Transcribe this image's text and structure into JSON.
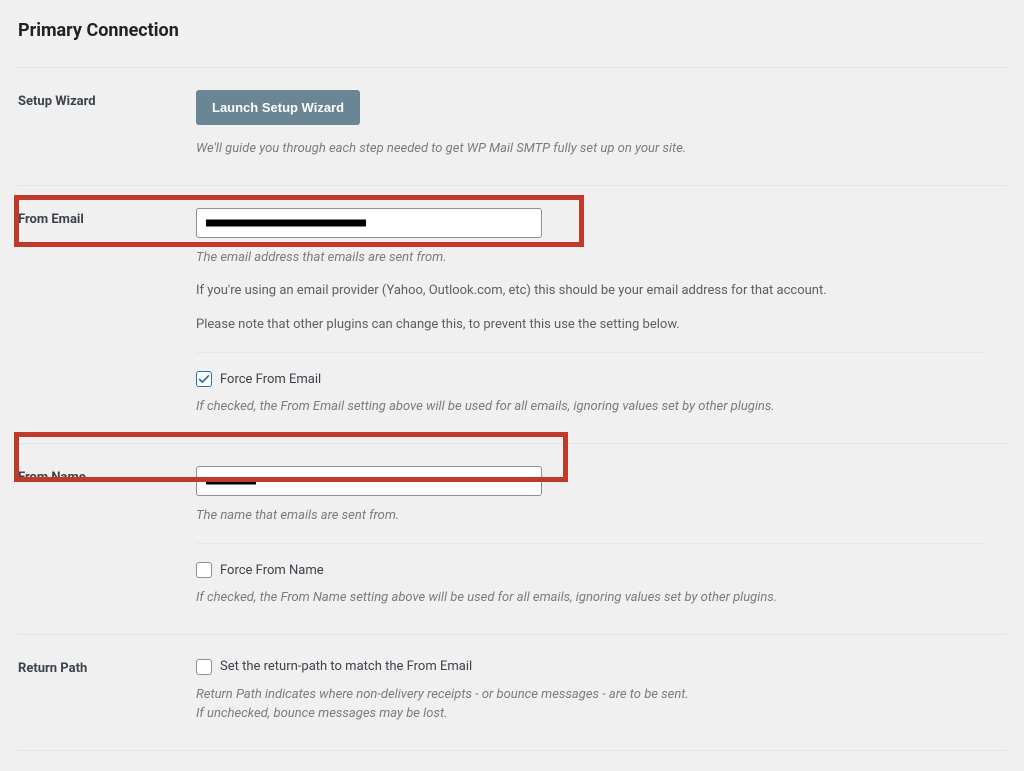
{
  "title": "Primary Connection",
  "setup": {
    "label": "Setup Wizard",
    "button": "Launch Setup Wizard",
    "helper": "We'll guide you through each step needed to get WP Mail SMTP fully set up on your site."
  },
  "from_email": {
    "label": "From Email",
    "helper1": "The email address that emails are sent from.",
    "helper2": "If you're using an email provider (Yahoo, Outlook.com, etc) this should be your email address for that account.",
    "helper3": "Please note that other plugins can change this, to prevent this use the setting below.",
    "force_label": "Force From Email",
    "force_helper": "If checked, the From Email setting above will be used for all emails, ignoring values set by other plugins."
  },
  "from_name": {
    "label": "From Name",
    "helper1": "The name that emails are sent from.",
    "force_label": "Force From Name",
    "force_helper": "If checked, the From Name setting above will be used for all emails, ignoring values set by other plugins."
  },
  "return_path": {
    "label": "Return Path",
    "checkbox_label": "Set the return-path to match the From Email",
    "helper1": "Return Path indicates where non-delivery receipts - or bounce messages - are to be sent.",
    "helper2": "If unchecked, bounce messages may be lost."
  }
}
